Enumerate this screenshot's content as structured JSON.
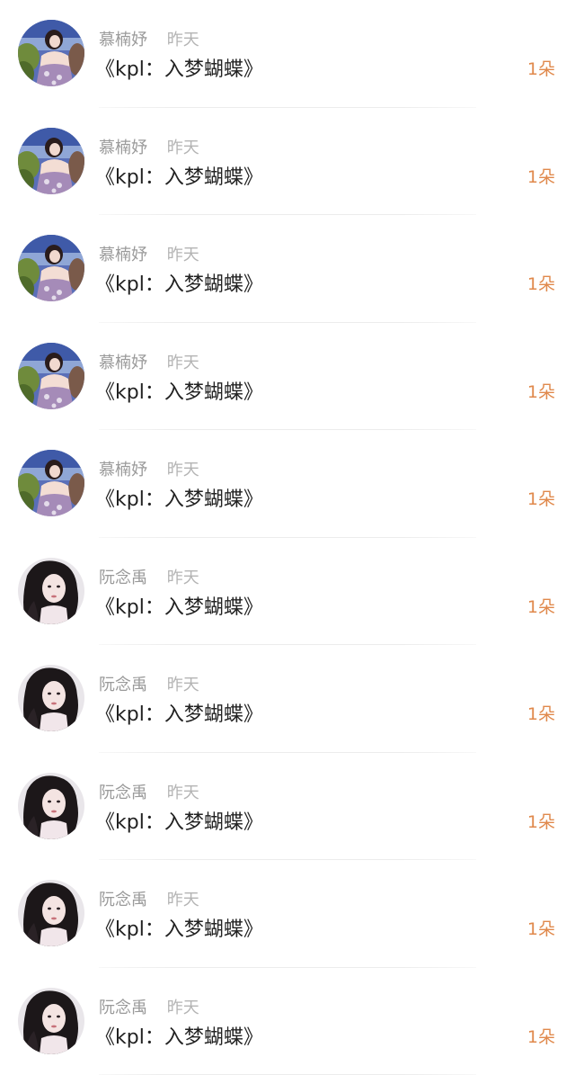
{
  "items": [
    {
      "name": "慕楠妤",
      "time": "昨天",
      "title": "《kpl：入梦蝴蝶》",
      "gift": "1朵",
      "avatar": "avatar-outdoor-girl"
    },
    {
      "name": "慕楠妤",
      "time": "昨天",
      "title": "《kpl：入梦蝴蝶》",
      "gift": "1朵",
      "avatar": "avatar-outdoor-girl"
    },
    {
      "name": "慕楠妤",
      "time": "昨天",
      "title": "《kpl：入梦蝴蝶》",
      "gift": "1朵",
      "avatar": "avatar-outdoor-girl"
    },
    {
      "name": "慕楠妤",
      "time": "昨天",
      "title": "《kpl：入梦蝴蝶》",
      "gift": "1朵",
      "avatar": "avatar-outdoor-girl"
    },
    {
      "name": "慕楠妤",
      "time": "昨天",
      "title": "《kpl：入梦蝴蝶》",
      "gift": "1朵",
      "avatar": "avatar-outdoor-girl"
    },
    {
      "name": "阮念禹",
      "time": "昨天",
      "title": "《kpl：入梦蝴蝶》",
      "gift": "1朵",
      "avatar": "avatar-dark-hair-girl"
    },
    {
      "name": "阮念禹",
      "time": "昨天",
      "title": "《kpl：入梦蝴蝶》",
      "gift": "1朵",
      "avatar": "avatar-dark-hair-girl"
    },
    {
      "name": "阮念禹",
      "time": "昨天",
      "title": "《kpl：入梦蝴蝶》",
      "gift": "1朵",
      "avatar": "avatar-dark-hair-girl"
    },
    {
      "name": "阮念禹",
      "time": "昨天",
      "title": "《kpl：入梦蝴蝶》",
      "gift": "1朵",
      "avatar": "avatar-dark-hair-girl"
    },
    {
      "name": "阮念禹",
      "time": "昨天",
      "title": "《kpl：入梦蝴蝶》",
      "gift": "1朵",
      "avatar": "avatar-dark-hair-girl"
    }
  ]
}
